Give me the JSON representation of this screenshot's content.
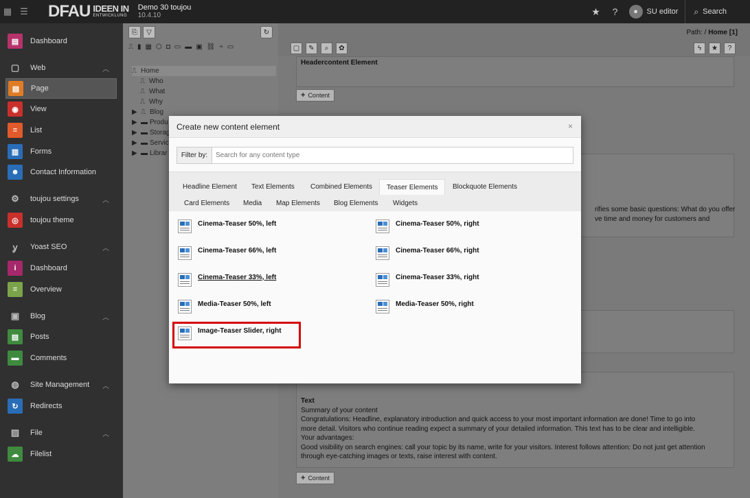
{
  "topbar": {
    "logo_main": "DFAU",
    "logo_line1": "IDEEN IN",
    "logo_line2": "ENTWICKLUNG",
    "site_name": "Demo 30 toujou",
    "version": "10.4.10",
    "user": "SU editor",
    "search_label": "Search"
  },
  "sidebar": {
    "items": [
      {
        "label": "Dashboard",
        "color": "#b5336b"
      },
      {
        "label": "Web",
        "group": true
      },
      {
        "label": "Page",
        "color": "#e07c26",
        "active": true
      },
      {
        "label": "View",
        "color": "#c9302c"
      },
      {
        "label": "List",
        "color": "#e05a2b"
      },
      {
        "label": "Forms",
        "color": "#2a6db7"
      },
      {
        "label": "Contact Information",
        "color": "#2a6db7"
      },
      {
        "label": "toujou settings",
        "group": true
      },
      {
        "label": "toujou theme",
        "color": "#c9302c"
      },
      {
        "label": "Yoast SEO",
        "group": true
      },
      {
        "label": "Dashboard",
        "color": "#a4286a"
      },
      {
        "label": "Overview",
        "color": "#7ba34a"
      },
      {
        "label": "Blog",
        "group": true
      },
      {
        "label": "Posts",
        "color": "#3f8a3f"
      },
      {
        "label": "Comments",
        "color": "#3f8a3f"
      },
      {
        "label": "Site Management",
        "group": true
      },
      {
        "label": "Redirects",
        "color": "#2a6db7"
      },
      {
        "label": "File",
        "group": true
      },
      {
        "label": "Filelist",
        "color": "#3f8a3f"
      }
    ]
  },
  "tree": {
    "items": [
      "Home",
      "Who",
      "What",
      "Why",
      "Blog",
      "Produ",
      "Storag",
      "Servic",
      "Librar"
    ]
  },
  "main": {
    "path_label": "Path: /",
    "path_page": "Home [1]",
    "header_element": "Headercontent Element",
    "add_content": "Content",
    "bg_partial1": "rifies some basic questions: What do you offer",
    "bg_partial2": "ve time and money for customers and",
    "text_heading": "Text",
    "text_lines": [
      "Summary of your content",
      "Congratulations: Headline, explanatory introduction and quick access to your most important information are done! Time to go into",
      "more detail. Visitors who continue reading expect a summary of your detailed information. This text has to be clear and intelligible.",
      "Your advantages:",
      "Good visibility on search engines: call your topic by its name, write for your visitors. Interest follows attention: Do not just get attention",
      "through eye-catching images or texts, raise interest with content."
    ]
  },
  "modal": {
    "title": "Create new content element",
    "close": "×",
    "filter_label": "Filter by:",
    "filter_placeholder": "Search for any content type",
    "tabs": [
      "Headline Element",
      "Text Elements",
      "Combined Elements",
      "Teaser Elements",
      "Blockquote Elements",
      "Card Elements",
      "Media",
      "Map Elements",
      "Blog Elements",
      "Widgets"
    ],
    "active_tab": "Teaser Elements",
    "elements": [
      "Cinema-Teaser 50%, left",
      "Cinema-Teaser 50%, right",
      "Cinema-Teaser 66%, left",
      "Cinema-Teaser 66%, right",
      "Cinema-Teaser 33%, left",
      "Cinema-Teaser 33%, right",
      "Media-Teaser 50%, left",
      "Media-Teaser 50%, right",
      "Image-Teaser Slider, right"
    ],
    "highlight_color": "#d40000"
  }
}
